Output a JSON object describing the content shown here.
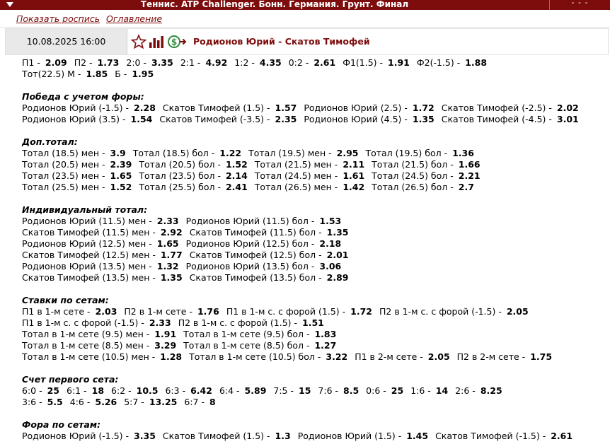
{
  "titlebar": {
    "title": "Теннис. ATP Challenger. Бонн. Германия. Грунт. Финал",
    "right": "- - -"
  },
  "links": {
    "schedule": "Показать роспись",
    "contents": "Оглавление"
  },
  "event": {
    "datetime": "10.08.2025 16:00",
    "match": "Родионов Юрий - Скатов Тимофей"
  },
  "sections": [
    {
      "heading": "",
      "rows": [
        [
          [
            "П1 -",
            "2.09"
          ],
          [
            "П2 -",
            "1.73"
          ],
          [
            "2:0 -",
            "3.35"
          ],
          [
            "2:1 -",
            "4.92"
          ],
          [
            "1:2 -",
            "4.35"
          ],
          [
            "0:2 -",
            "2.61"
          ],
          [
            "Ф1(1.5) -",
            "1.91"
          ],
          [
            "Ф2(-1.5) -",
            "1.88"
          ]
        ],
        [
          [
            "Тот(22.5) М -",
            "1.85"
          ],
          [
            "Б -",
            "1.95"
          ]
        ]
      ]
    },
    {
      "heading": "Победа с учетом форы:",
      "rows": [
        [
          [
            "Родионов Юрий (-1.5) -",
            "2.28"
          ],
          [
            "Скатов Тимофей (1.5) -",
            "1.57"
          ],
          [
            "Родионов Юрий (2.5) -",
            "1.72"
          ],
          [
            "Скатов Тимофей (-2.5) -",
            "2.02"
          ]
        ],
        [
          [
            "Родионов Юрий (3.5) -",
            "1.54"
          ],
          [
            "Скатов Тимофей (-3.5) -",
            "2.35"
          ],
          [
            "Родионов Юрий (4.5) -",
            "1.35"
          ],
          [
            "Скатов Тимофей (-4.5) -",
            "3.01"
          ]
        ]
      ]
    },
    {
      "heading": "Доп.тотал:",
      "rows": [
        [
          [
            "Тотал (18.5) мен -",
            "3.9"
          ],
          [
            "Тотал (18.5) бол -",
            "1.22"
          ],
          [
            "Тотал (19.5) мен -",
            "2.95"
          ],
          [
            "Тотал (19.5) бол -",
            "1.36"
          ]
        ],
        [
          [
            "Тотал (20.5) мен -",
            "2.39"
          ],
          [
            "Тотал (20.5) бол -",
            "1.52"
          ],
          [
            "Тотал (21.5) мен -",
            "2.11"
          ],
          [
            "Тотал (21.5) бол -",
            "1.66"
          ]
        ],
        [
          [
            "Тотал (23.5) мен -",
            "1.65"
          ],
          [
            "Тотал (23.5) бол -",
            "2.14"
          ],
          [
            "Тотал (24.5) мен -",
            "1.61"
          ],
          [
            "Тотал (24.5) бол -",
            "2.21"
          ]
        ],
        [
          [
            "Тотал (25.5) мен -",
            "1.52"
          ],
          [
            "Тотал (25.5) бол -",
            "2.41"
          ],
          [
            "Тотал (26.5) мен -",
            "1.42"
          ],
          [
            "Тотал (26.5) бол -",
            "2.7"
          ]
        ]
      ]
    },
    {
      "heading": "Индивидуальный тотал:",
      "rows": [
        [
          [
            "Родионов Юрий (11.5) мен -",
            "2.33"
          ],
          [
            "Родионов Юрий (11.5) бол -",
            "1.53"
          ]
        ],
        [
          [
            "Скатов Тимофей (11.5) мен -",
            "2.92"
          ],
          [
            "Скатов Тимофей (11.5) бол -",
            "1.35"
          ]
        ],
        [
          [
            "Родионов Юрий (12.5) мен -",
            "1.65"
          ],
          [
            "Родионов Юрий (12.5) бол -",
            "2.18"
          ]
        ],
        [
          [
            "Скатов Тимофей (12.5) мен -",
            "1.77"
          ],
          [
            "Скатов Тимофей (12.5) бол -",
            "2.01"
          ]
        ],
        [
          [
            "Родионов Юрий (13.5) мен -",
            "1.32"
          ],
          [
            "Родионов Юрий (13.5) бол -",
            "3.06"
          ]
        ],
        [
          [
            "Скатов Тимофей (13.5) мен -",
            "1.35"
          ],
          [
            "Скатов Тимофей (13.5) бол -",
            "2.89"
          ]
        ]
      ]
    },
    {
      "heading": "Ставки по сетам:",
      "rows": [
        [
          [
            "П1 в 1-м сете -",
            "2.03"
          ],
          [
            "П2 в 1-м сете -",
            "1.76"
          ],
          [
            "П1 в 1-м с. с форой (1.5) -",
            "1.72"
          ],
          [
            "П2 в 1-м с. с форой (-1.5) -",
            "2.05"
          ]
        ],
        [
          [
            "П1 в 1-м с. с форой (-1.5) -",
            "2.33"
          ],
          [
            "П2 в 1-м с. с форой (1.5) -",
            "1.51"
          ]
        ],
        [
          [
            "Тотал в 1-м сете (9.5) мен -",
            "1.91"
          ],
          [
            "Тотал в 1-м сете (9.5) бол -",
            "1.83"
          ]
        ],
        [
          [
            "Тотал в 1-м сете (8.5) мен -",
            "3.29"
          ],
          [
            "Тотал в 1-м сете (8.5) бол -",
            "1.27"
          ]
        ],
        [
          [
            "Тотал в 1-м сете (10.5) мен -",
            "1.28"
          ],
          [
            "Тотал в 1-м сете (10.5) бол -",
            "3.22"
          ],
          [
            "П1 в 2-м сете -",
            "2.05"
          ],
          [
            "П2 в 2-м сете -",
            "1.75"
          ]
        ]
      ]
    },
    {
      "heading": "Счет первого сета:",
      "rows": [
        [
          [
            "6:0 -",
            "25"
          ],
          [
            "6:1 -",
            "18"
          ],
          [
            "6:2 -",
            "10.5"
          ],
          [
            "6:3 -",
            "6.42"
          ],
          [
            "6:4 -",
            "5.89"
          ],
          [
            "7:5 -",
            "15"
          ],
          [
            "7:6 -",
            "8.5"
          ],
          [
            "0:6 -",
            "25"
          ],
          [
            "1:6 -",
            "14"
          ],
          [
            "2:6 -",
            "8.25"
          ]
        ],
        [
          [
            "3:6 -",
            "5.5"
          ],
          [
            "4:6 -",
            "5.26"
          ],
          [
            "5:7 -",
            "13.25"
          ],
          [
            "6:7 -",
            "8"
          ]
        ]
      ]
    },
    {
      "heading": "Фора по сетам:",
      "rows": [
        [
          [
            "Родионов Юрий (-1.5) -",
            "3.35"
          ],
          [
            "Скатов Тимофей (1.5) -",
            "1.3"
          ],
          [
            "Родионов Юрий (1.5) -",
            "1.45"
          ],
          [
            "Скатов Тимофей (-1.5) -",
            "2.61"
          ]
        ]
      ]
    }
  ],
  "colors": {
    "brand": "#7d0c0c",
    "date_bg": "#e9e9e9",
    "icon_accent": "#2e8b3c"
  },
  "icons": [
    "star-icon",
    "stats-icon",
    "cashout-icon"
  ]
}
